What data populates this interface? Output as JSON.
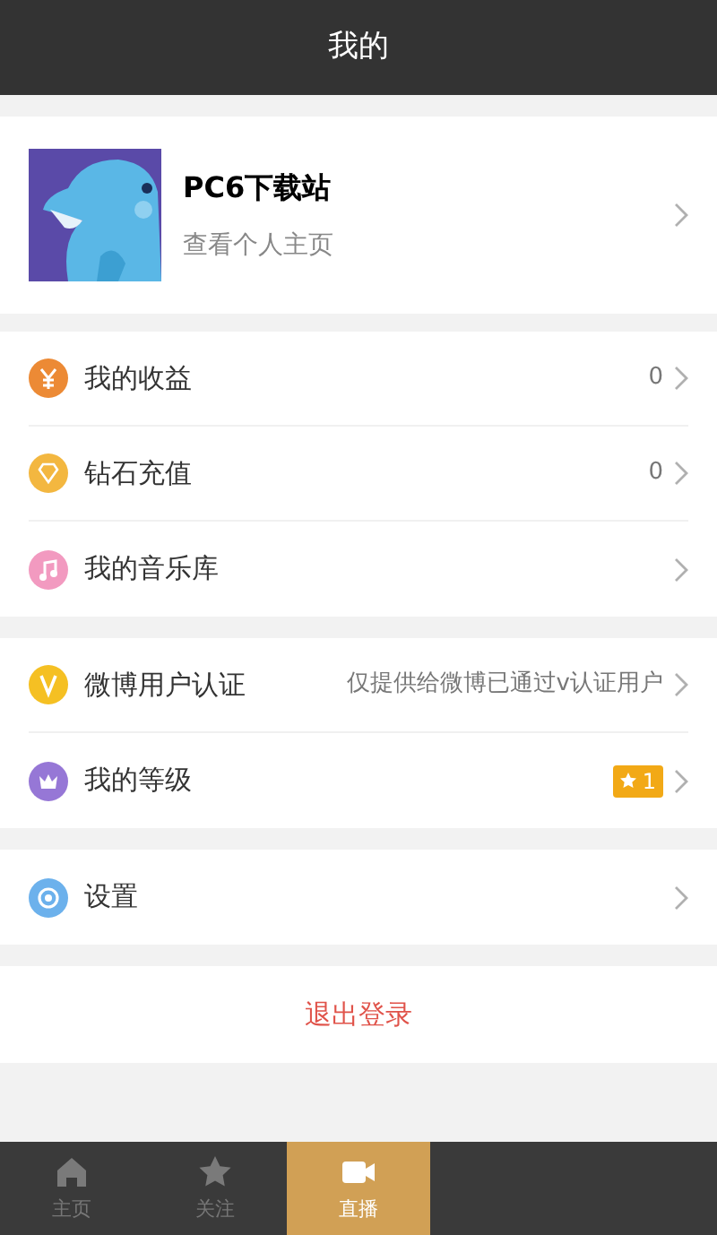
{
  "title": "我的",
  "profile": {
    "name": "PC6下载站",
    "subtitle": "查看个人主页"
  },
  "groups": [
    {
      "items": [
        {
          "kind": "yen",
          "label": "我的收益",
          "value": "0"
        },
        {
          "kind": "diamond",
          "label": "钻石充值",
          "value": "0"
        },
        {
          "kind": "music",
          "label": "我的音乐库"
        }
      ]
    },
    {
      "items": [
        {
          "kind": "v",
          "label": "微博用户认证",
          "value": "仅提供给微博已通过v认证用户"
        },
        {
          "kind": "crown",
          "label": "我的等级",
          "badge": "1"
        }
      ]
    },
    {
      "items": [
        {
          "kind": "gear",
          "label": "设置"
        }
      ]
    }
  ],
  "logout": "退出登录",
  "tabs": [
    {
      "kind": "home",
      "label": "主页",
      "selected": false
    },
    {
      "kind": "star",
      "label": "关注",
      "selected": false
    },
    {
      "kind": "camera",
      "label": "直播",
      "selected": true
    }
  ]
}
